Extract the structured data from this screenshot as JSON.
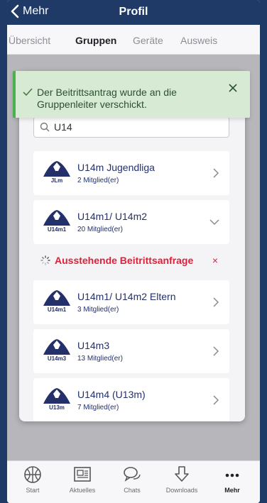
{
  "header": {
    "back_label": "Mehr",
    "title": "Profil"
  },
  "tabs": [
    {
      "label": "Übersicht",
      "active": false
    },
    {
      "label": "Gruppen",
      "active": true
    },
    {
      "label": "Geräte",
      "active": false
    },
    {
      "label": "Ausweis",
      "active": false
    }
  ],
  "toast": {
    "message": "Der Beitrittsantrag wurde an die Gruppenleiter verschickt."
  },
  "search": {
    "value": "U14"
  },
  "groups": [
    {
      "name": "U14m Jugendliga",
      "members": "2 Mitglied(er)",
      "logo_text": "JLm",
      "expanded": false
    },
    {
      "name": "U14m1/ U14m2",
      "members": "20 Mitglied(er)",
      "logo_text": "U14m1",
      "expanded": true
    },
    {
      "name": "U14m1/ U14m2 Eltern",
      "members": "3 Mitglied(er)",
      "logo_text": "U14m1",
      "expanded": false
    },
    {
      "name": "U14m3",
      "members": "13 Mitglied(er)",
      "logo_text": "U14m3",
      "expanded": false
    },
    {
      "name": "U14m4 (U13m)",
      "members": "7 Mitglied(er)",
      "logo_text": "U13m",
      "expanded": false
    }
  ],
  "pending": {
    "label": "Ausstehende Beitrittsanfrage",
    "cancel": "×"
  },
  "bottom_nav": [
    {
      "label": "Start",
      "icon": "basketball-icon",
      "active": false
    },
    {
      "label": "Aktuelles",
      "icon": "newspaper-icon",
      "active": false
    },
    {
      "label": "Chats",
      "icon": "chat-bubbles-icon",
      "active": false
    },
    {
      "label": "Downloads",
      "icon": "download-icon",
      "active": false
    },
    {
      "label": "Mehr",
      "icon": "more-dots-icon",
      "active": true
    }
  ],
  "colors": {
    "primary": "#1f3a66",
    "danger": "#e0203a",
    "success": "#4caf50"
  }
}
